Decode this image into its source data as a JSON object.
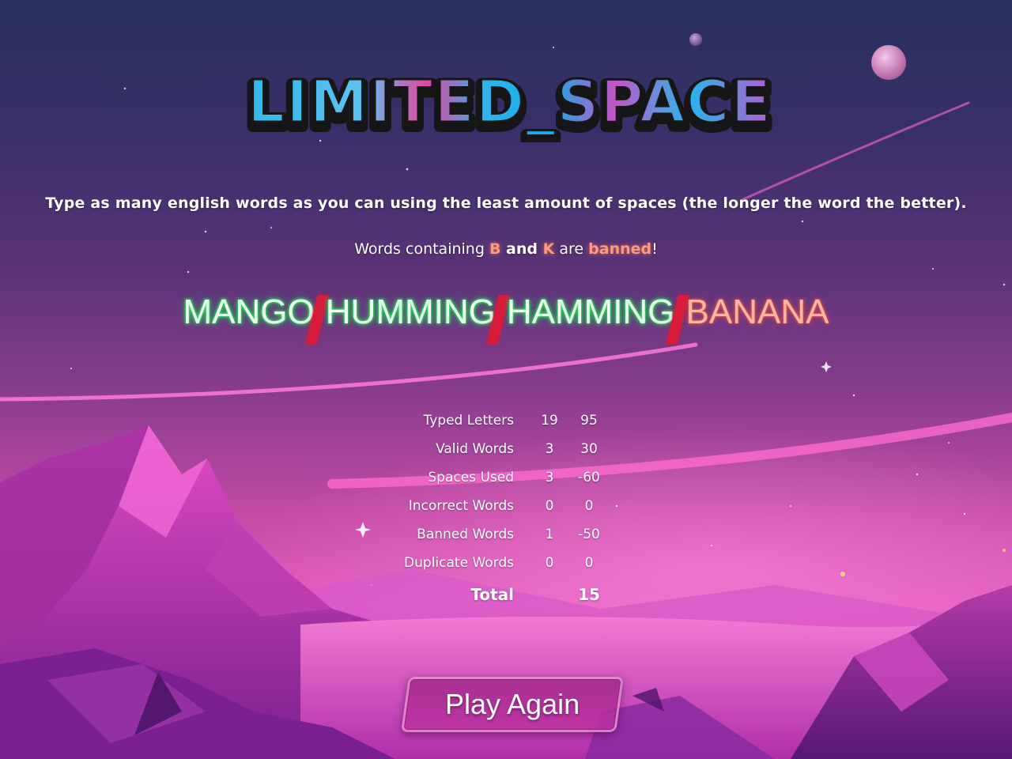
{
  "logo": {
    "text": "LIMITED_SPACE",
    "part1": "LIMITED",
    "underscore": "_",
    "part2": "SPACE"
  },
  "instructions": "Type as many english words as you can using the least amount of spaces (the longer the word the better).",
  "banned_notice": {
    "prefix": "Words containing ",
    "letter1": "B",
    "and": " and ",
    "letter2": "K",
    "are": " are ",
    "banned": "banned",
    "suffix": "!"
  },
  "typed_words": [
    {
      "text": "MANGO",
      "status": "valid"
    },
    {
      "text": "HUMMING",
      "status": "valid"
    },
    {
      "text": "HAMMING",
      "status": "valid"
    },
    {
      "text": "BANANA",
      "status": "banned"
    }
  ],
  "stats": [
    {
      "label": "Typed Letters",
      "count": "19",
      "points": "95"
    },
    {
      "label": "Valid Words",
      "count": "3",
      "points": "30"
    },
    {
      "label": "Spaces Used",
      "count": "3",
      "points": "-60"
    },
    {
      "label": "Incorrect Words",
      "count": "0",
      "points": "0"
    },
    {
      "label": "Banned Words",
      "count": "1",
      "points": "-50"
    },
    {
      "label": "Duplicate Words",
      "count": "0",
      "points": "0"
    }
  ],
  "total": {
    "label": "Total",
    "points": "15"
  },
  "play_again": "Play Again",
  "colors": {
    "valid_glow": "#19d84a",
    "banned_glow": "#ff5a3c",
    "space_marker": "#d91b3a",
    "highlight": "#ff9a80"
  }
}
